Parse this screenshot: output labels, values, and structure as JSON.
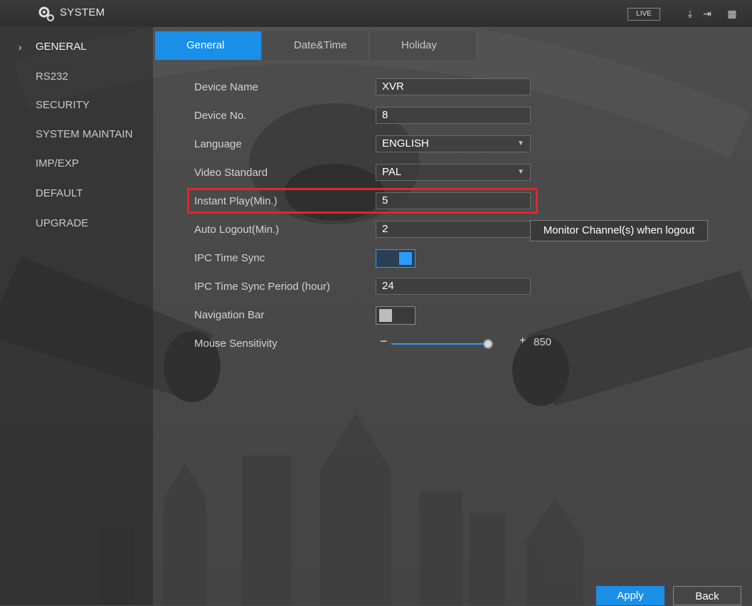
{
  "header": {
    "title": "SYSTEM",
    "live_label": "LIVE",
    "icons": [
      "gear-icon",
      "download-icon",
      "logout-icon",
      "grid-icon"
    ]
  },
  "sidebar": {
    "items": [
      {
        "label": "GENERAL",
        "active": true
      },
      {
        "label": "RS232"
      },
      {
        "label": "SECURITY"
      },
      {
        "label": "SYSTEM MAINTAIN"
      },
      {
        "label": "IMP/EXP"
      },
      {
        "label": "DEFAULT"
      },
      {
        "label": "UPGRADE"
      }
    ]
  },
  "tabs": [
    {
      "label": "General",
      "active": true
    },
    {
      "label": "Date&Time"
    },
    {
      "label": "Holiday"
    }
  ],
  "form": {
    "device_name": {
      "label": "Device Name",
      "value": "XVR"
    },
    "device_no": {
      "label": "Device No.",
      "value": "8"
    },
    "language": {
      "label": "Language",
      "value": "ENGLISH"
    },
    "video_standard": {
      "label": "Video Standard",
      "value": "PAL"
    },
    "instant_play": {
      "label": "Instant Play(Min.)",
      "value": "5"
    },
    "auto_logout": {
      "label": "Auto Logout(Min.)",
      "value": "2",
      "extra_button": "Monitor Channel(s) when logout"
    },
    "ipc_time_sync": {
      "label": "IPC Time Sync",
      "enabled": true
    },
    "ipc_sync_period": {
      "label": "IPC Time Sync Period (hour)",
      "value": "24"
    },
    "navigation_bar": {
      "label": "Navigation Bar",
      "enabled": false
    },
    "mouse_sensitivity": {
      "label": "Mouse Sensitivity",
      "value": "850",
      "level": 0.85
    }
  },
  "buttons": {
    "apply": "Apply",
    "back": "Back"
  },
  "colors": {
    "accent": "#1a8fe8",
    "highlight": "#e0262b"
  }
}
